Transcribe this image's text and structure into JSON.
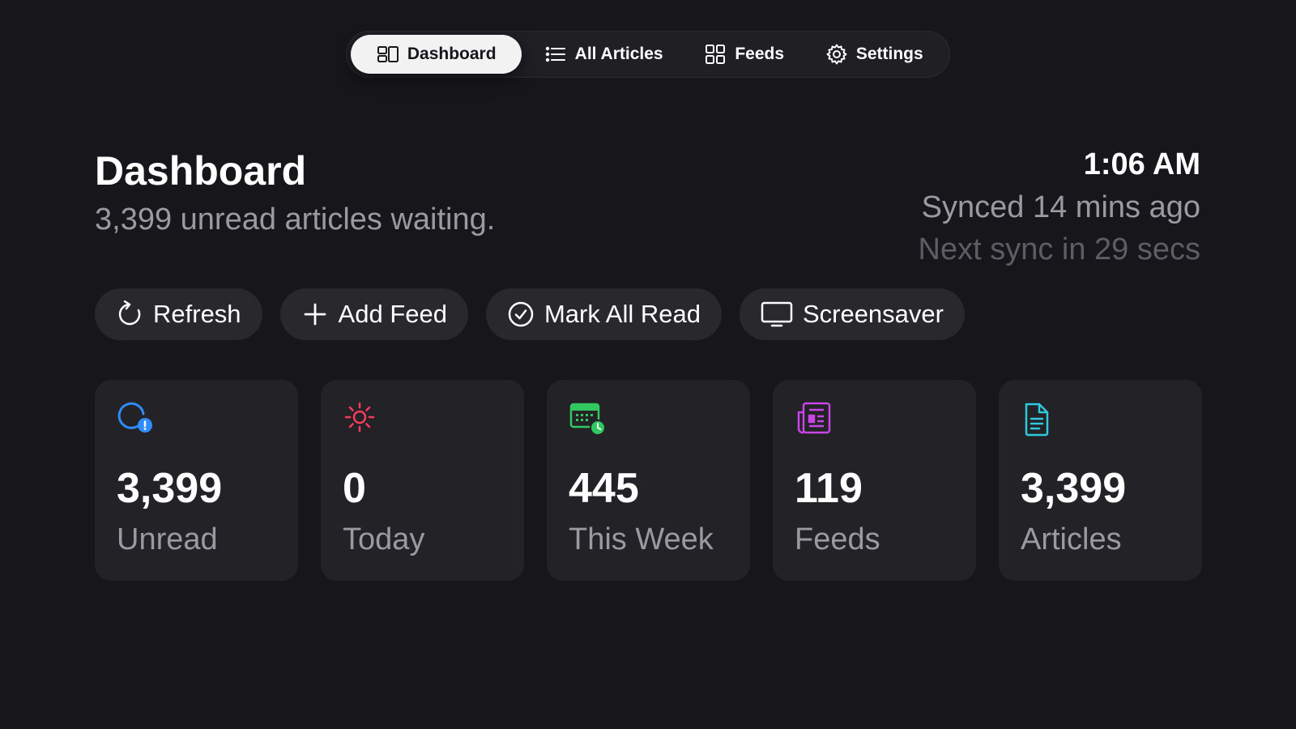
{
  "nav": {
    "tabs": [
      {
        "label": "Dashboard",
        "icon": "dashboard-icon",
        "active": true
      },
      {
        "label": "All Articles",
        "icon": "list-icon",
        "active": false
      },
      {
        "label": "Feeds",
        "icon": "grid-icon",
        "active": false
      },
      {
        "label": "Settings",
        "icon": "gear-icon",
        "active": false
      }
    ]
  },
  "header": {
    "title": "Dashboard",
    "subtitle": "3,399 unread articles waiting.",
    "time": "1:06 AM",
    "synced": "Synced 14 mins ago",
    "next_sync": "Next sync in 29 secs"
  },
  "actions": [
    {
      "label": "Refresh",
      "icon": "refresh-icon"
    },
    {
      "label": "Add Feed",
      "icon": "plus-icon"
    },
    {
      "label": "Mark All Read",
      "icon": "check-circle-icon"
    },
    {
      "label": "Screensaver",
      "icon": "monitor-icon"
    }
  ],
  "stats": [
    {
      "value": "3,399",
      "label": "Unread",
      "icon": "unread-icon",
      "color": "#2f8cff"
    },
    {
      "value": "0",
      "label": "Today",
      "icon": "sun-icon",
      "color": "#ff3b5c"
    },
    {
      "value": "445",
      "label": "This Week",
      "icon": "calendar-clock-icon",
      "color": "#32c861"
    },
    {
      "value": "119",
      "label": "Feeds",
      "icon": "newspaper-icon",
      "color": "#c945e6"
    },
    {
      "value": "3,399",
      "label": "Articles",
      "icon": "document-icon",
      "color": "#2ec9dc"
    }
  ]
}
